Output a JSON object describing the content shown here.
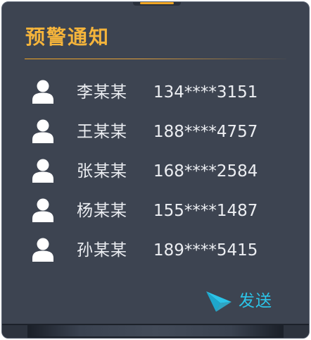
{
  "panel": {
    "title": "预警通知",
    "accent_color": "#f5b43b",
    "background_color": "#3d4451"
  },
  "contacts": [
    {
      "name": "李某某",
      "phone": "134****3151",
      "icon": "person-icon"
    },
    {
      "name": "王某某",
      "phone": "188****4757",
      "icon": "person-icon"
    },
    {
      "name": "张某某",
      "phone": "168****2584",
      "icon": "person-icon"
    },
    {
      "name": "杨某某",
      "phone": "155****1487",
      "icon": "person-icon"
    },
    {
      "name": "孙某某",
      "phone": "189****5415",
      "icon": "person-icon"
    }
  ],
  "send": {
    "label": "发送",
    "icon": "paper-plane-icon",
    "color": "#2bc4e8"
  }
}
